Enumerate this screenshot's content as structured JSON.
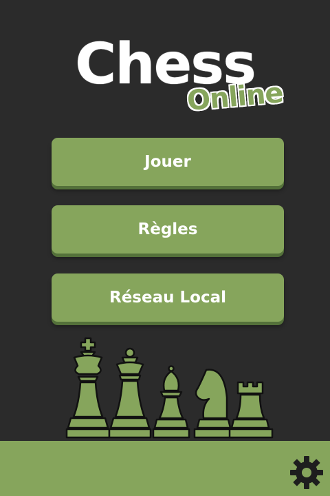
{
  "logo": {
    "title": "Chess",
    "subtitle": "Online"
  },
  "menu": {
    "play_label": "Jouer",
    "rules_label": "Règles",
    "lan_label": "Réseau Local"
  },
  "icons": {
    "settings": "gear-icon",
    "pieces": [
      "king-icon",
      "queen-icon",
      "bishop-icon",
      "knight-icon",
      "rook-icon"
    ]
  },
  "colors": {
    "background": "#2b2b2b",
    "accent_green": "#86a55c",
    "button_shadow": "#54713a",
    "text": "#ffffff"
  }
}
